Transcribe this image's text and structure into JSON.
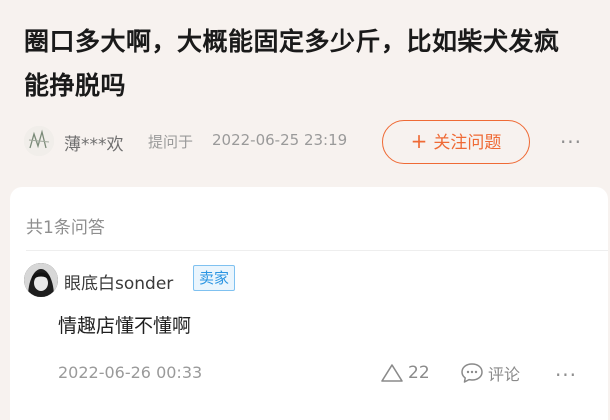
{
  "question": {
    "title": "圈口多大啊，大概能固定多少斤，比如柴犬发疯能挣脱吗",
    "asker_name": "薄***欢",
    "asked_prefix": "提问于",
    "asked_time": "2022-06-25 23:19",
    "follow_label": "关注问题",
    "follow_icon": "plus-icon",
    "more_label": "···"
  },
  "answers": {
    "count_label": "共1条问答",
    "items": [
      {
        "author": "眼底白sonder",
        "badge": "卖家",
        "text": "情趣店懂不懂啊",
        "time": "2022-06-26 00:33",
        "likes": "22",
        "comment_label": "评论",
        "more_label": "···"
      }
    ]
  },
  "colors": {
    "accent": "#ef6a35",
    "badge_blue": "#2b95e2",
    "page_bg": "#f7f2ef"
  }
}
